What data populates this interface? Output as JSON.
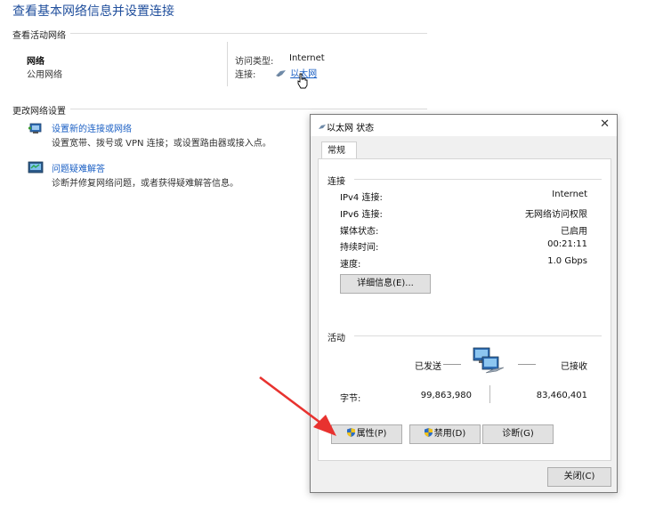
{
  "page": {
    "title": "查看基本网络信息并设置连接"
  },
  "active_networks": {
    "section_label": "查看活动网络",
    "network_name": "网络",
    "network_type": "公用网络",
    "access_type_label": "访问类型:",
    "access_type_value": "Internet",
    "connection_label": "连接:",
    "connection_value": "以太网"
  },
  "change_settings": {
    "section_label": "更改网络设置",
    "items": [
      {
        "title": "设置新的连接或网络",
        "desc": "设置宽带、拨号或 VPN 连接；或设置路由器或接入点。",
        "icon": "network-setup-icon"
      },
      {
        "title": "问题疑难解答",
        "desc": "诊断并修复网络问题，或者获得疑难解答信息。",
        "icon": "troubleshoot-icon"
      }
    ]
  },
  "dialog": {
    "title": "以太网 状态",
    "tab": "常规",
    "connection": {
      "section": "连接",
      "rows": [
        {
          "label": "IPv4 连接:",
          "value": "Internet"
        },
        {
          "label": "IPv6 连接:",
          "value": "无网络访问权限"
        },
        {
          "label": "媒体状态:",
          "value": "已启用"
        },
        {
          "label": "持续时间:",
          "value": "00:21:11"
        },
        {
          "label": "速度:",
          "value": "1.0 Gbps"
        }
      ],
      "details_button": "详细信息(E)..."
    },
    "activity": {
      "section": "活动",
      "sent_label": "已发送",
      "received_label": "已接收",
      "bytes_label": "字节:",
      "bytes_sent": "99,863,980",
      "bytes_received": "83,460,401"
    },
    "buttons": {
      "properties": "属性(P)",
      "disable": "禁用(D)",
      "diagnose": "诊断(G)",
      "close": "关闭(C)"
    }
  },
  "colors": {
    "link": "#1a5fc4",
    "title": "#1f4e9c",
    "arrow": "#e8322f"
  }
}
